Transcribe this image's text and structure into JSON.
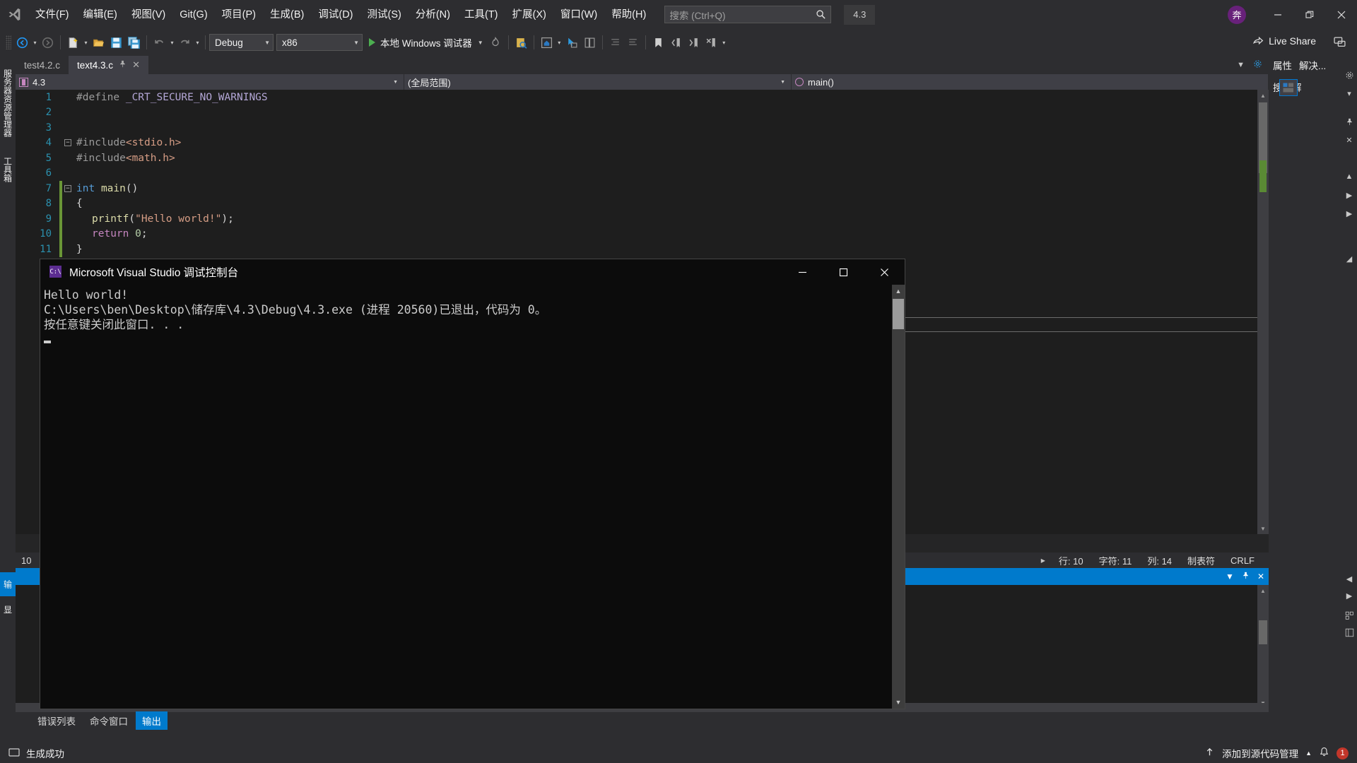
{
  "titlebar": {
    "logo": "visual-studio-logo",
    "menus": [
      "文件(F)",
      "编辑(E)",
      "视图(V)",
      "Git(G)",
      "项目(P)",
      "生成(B)",
      "调试(D)",
      "测试(S)",
      "分析(N)",
      "工具(T)",
      "扩展(X)",
      "窗口(W)",
      "帮助(H)"
    ],
    "search_placeholder": "搜索 (Ctrl+Q)",
    "version_chip": "4.3",
    "avatar_initial": "奔",
    "window_buttons": {
      "minimize": "—",
      "restore": "❐",
      "close": "✕"
    }
  },
  "toolbar": {
    "config": "Debug",
    "platform": "x86",
    "run_label": "本地 Windows 调试器",
    "live_share": "Live Share",
    "accent": "#007acc"
  },
  "editor": {
    "tabs": [
      {
        "label": "test4.2.c",
        "active": false
      },
      {
        "label": "text4.3.c",
        "active": true,
        "pin": "⌐",
        "close": "✕"
      }
    ],
    "nav": {
      "project": "4.3",
      "scope": "(全局范围)",
      "member": "main()"
    },
    "code_lines": [
      {
        "n": "1",
        "indent": 0,
        "fold": "",
        "changed": false,
        "tokens": [
          {
            "t": "#define ",
            "c": "k-pp"
          },
          {
            "t": "_CRT_SECURE_NO_WARNINGS",
            "c": "k-macro"
          }
        ]
      },
      {
        "n": "2",
        "indent": 0,
        "fold": "",
        "changed": false,
        "tokens": []
      },
      {
        "n": "3",
        "indent": 0,
        "fold": "",
        "changed": false,
        "tokens": []
      },
      {
        "n": "4",
        "indent": 0,
        "fold": "-",
        "changed": false,
        "tokens": [
          {
            "t": "#include",
            "c": "k-pp"
          },
          {
            "t": "<stdio.h>",
            "c": "k-str"
          }
        ]
      },
      {
        "n": "5",
        "indent": 0,
        "fold": "|",
        "changed": false,
        "tokens": [
          {
            "t": "#include",
            "c": "k-pp"
          },
          {
            "t": "<math.h>",
            "c": "k-str"
          }
        ]
      },
      {
        "n": "6",
        "indent": 0,
        "fold": "",
        "changed": false,
        "tokens": []
      },
      {
        "n": "7",
        "indent": 0,
        "fold": "-",
        "changed": true,
        "tokens": [
          {
            "t": "int",
            "c": "k-kw"
          },
          {
            "t": " ",
            "c": "k-plain"
          },
          {
            "t": "main",
            "c": "k-fn"
          },
          {
            "t": "()",
            "c": "k-plain"
          }
        ]
      },
      {
        "n": "8",
        "indent": 0,
        "fold": "|",
        "changed": true,
        "tokens": [
          {
            "t": "{",
            "c": "k-plain"
          }
        ]
      },
      {
        "n": "9",
        "indent": 1,
        "fold": "|",
        "changed": true,
        "tokens": [
          {
            "t": "printf",
            "c": "k-fn"
          },
          {
            "t": "(",
            "c": "k-plain"
          },
          {
            "t": "\"Hello world!\"",
            "c": "k-str"
          },
          {
            "t": ");",
            "c": "k-plain"
          }
        ]
      },
      {
        "n": "10",
        "indent": 1,
        "fold": "|",
        "changed": true,
        "tokens": [
          {
            "t": "return",
            "c": "k-kw2"
          },
          {
            "t": " ",
            "c": "k-plain"
          },
          {
            "t": "0",
            "c": "k-num"
          },
          {
            "t": ";",
            "c": "k-plain"
          }
        ]
      },
      {
        "n": "11",
        "indent": 0,
        "fold": "|",
        "changed": true,
        "tokens": [
          {
            "t": "}",
            "c": "k-plain"
          }
        ]
      }
    ],
    "status": {
      "zoom": "10",
      "line": "行: 10",
      "char": "字符: 11",
      "col": "列: 14",
      "tabs_mode": "制表符",
      "line_endings": "CRLF"
    }
  },
  "console": {
    "icon_text": "C:\\",
    "title": "Microsoft Visual Studio 调试控制台",
    "window_buttons": {
      "minimize": "—",
      "maximize": "❐",
      "close": "✕"
    },
    "output_lines": [
      "Hello world!",
      "C:\\Users\\ben\\Desktop\\储存库\\4.3\\Debug\\4.3.exe (进程 20560)已退出，代码为 0。",
      "按任意键关闭此窗口. . ."
    ]
  },
  "output_panel": {
    "title": "",
    "panel_tabs": [
      {
        "label": "错误列表",
        "active": false
      },
      {
        "label": "命令窗口",
        "active": false
      },
      {
        "label": "输出",
        "active": true
      }
    ],
    "header_buttons": {
      "dropdown": "▼",
      "pin": "⌐",
      "close": "✕"
    }
  },
  "left_rail": {
    "tabs": [
      "服务器资源管理器",
      "工具箱"
    ]
  },
  "right_dock": {
    "properties": "属性",
    "solution_explorer": "解决...",
    "search_label": "搜索解"
  },
  "statusbar": {
    "build_status": "生成成功",
    "source_control": "添加到源代码管理",
    "notification_count": "1"
  }
}
